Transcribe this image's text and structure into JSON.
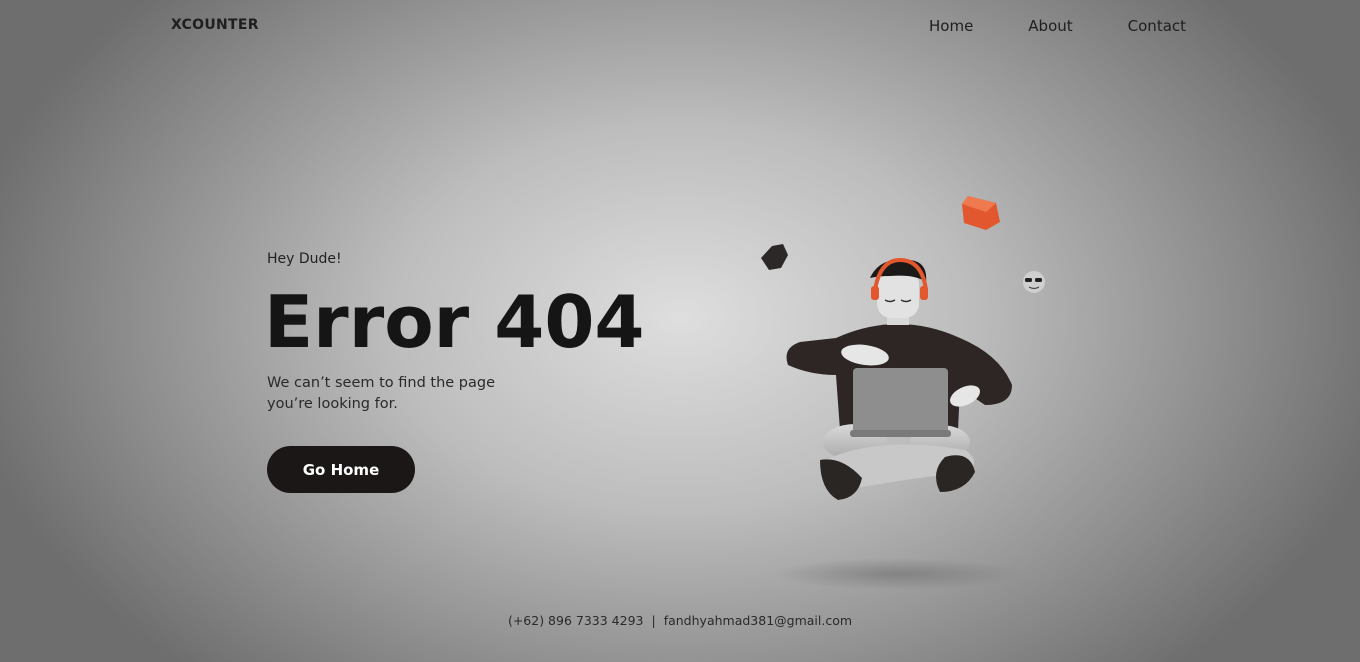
{
  "brand": "XCOUNTER",
  "nav": {
    "home": "Home",
    "about": "About",
    "contact": "Contact"
  },
  "hero": {
    "greeting": "Hey Dude!",
    "title": "Error 404",
    "description_line1": "We can’t seem to find the page",
    "description_line2": "you’re looking for.",
    "button_label": "Go Home"
  },
  "footer": {
    "phone": "(+62) 896 7333 4293",
    "separator": "|",
    "email": "fandhyahmad381@gmail.com"
  },
  "colors": {
    "button_bg": "#1a1716",
    "accent_orange": "#e2572d",
    "dark_shape": "#2b2827"
  }
}
